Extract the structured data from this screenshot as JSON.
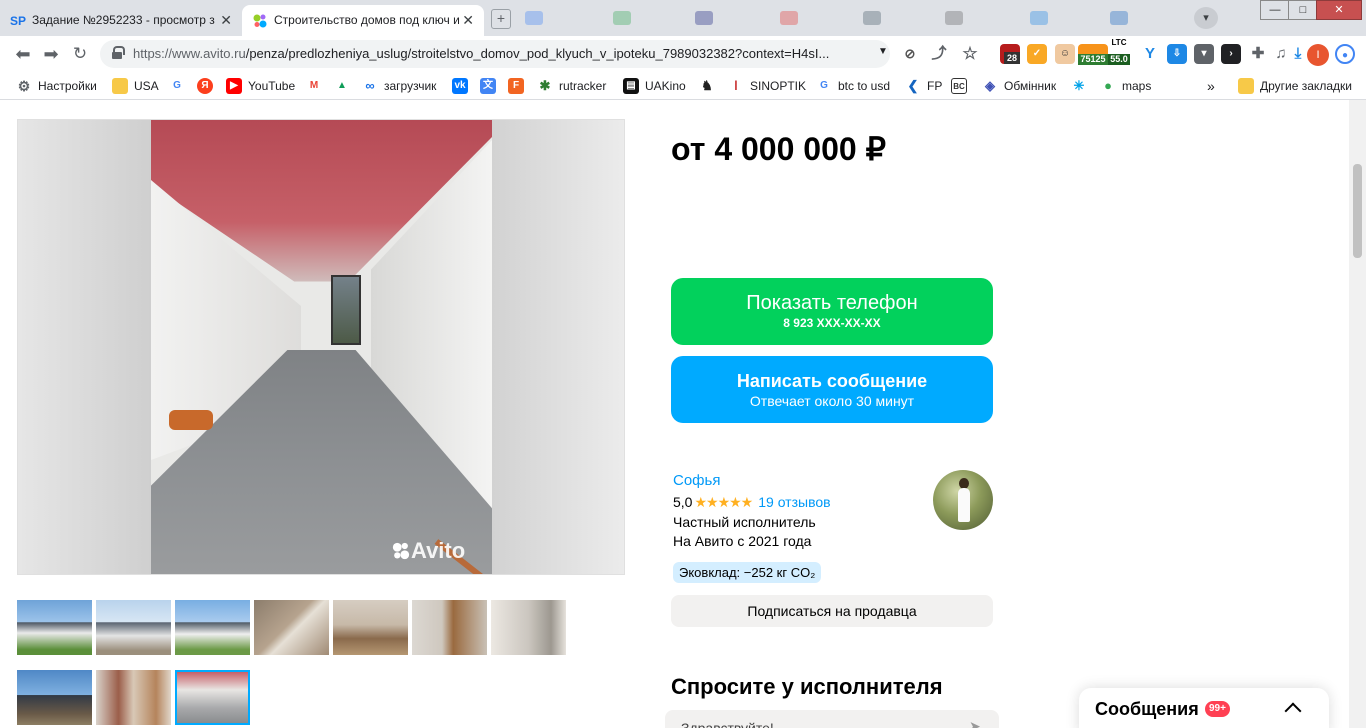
{
  "browser": {
    "tabs": [
      {
        "favicon": "SP",
        "title": "Задание №2952233 - просмотр з",
        "active": false
      },
      {
        "favicon": "avito-icon",
        "title": "Строительство домов под ключ и",
        "active": true
      }
    ],
    "url_prefix": "https://www.avito.ru",
    "url_path": "/penza/predlozheniya_uslug/stroitelstvo_domov_pod_klyuch_v_ipoteku_7989032382?context=H4sI...",
    "extension_badges": {
      "vpn": "28",
      "btc": "75125",
      "ltc_label": "LTC",
      "ltc": "55.0"
    },
    "profile_initial": "I",
    "window_controls": {
      "minimize": "—",
      "maximize": "□",
      "close": "✕"
    },
    "bookmarks": [
      {
        "label": "Настройки",
        "icon": "gear-icon",
        "color": "#5f6368"
      },
      {
        "label": "USA",
        "icon": "folder-icon",
        "color": "#f7c948"
      },
      {
        "label": "",
        "icon": "google-icon",
        "color": "#4285f4"
      },
      {
        "label": "",
        "icon": "yandex-icon",
        "color": "#fc3f1d"
      },
      {
        "label": "YouTube",
        "icon": "youtube-icon",
        "color": "#ff0000"
      },
      {
        "label": "",
        "icon": "gmail-icon",
        "color": "#ea4335"
      },
      {
        "label": "",
        "icon": "drive-icon",
        "color": "#0f9d58"
      },
      {
        "label": "загрузчик",
        "icon": "infinity-icon",
        "color": "#1a73e8"
      },
      {
        "label": "",
        "icon": "vk-icon",
        "color": "#0077ff"
      },
      {
        "label": "",
        "icon": "translate-icon",
        "color": "#4285f4"
      },
      {
        "label": "",
        "icon": "f-icon",
        "color": "#f26522"
      },
      {
        "label": "rutracker",
        "icon": "rutracker-icon",
        "color": "#2e7d32"
      },
      {
        "label": "UAKino",
        "icon": "film-icon",
        "color": "#111111"
      },
      {
        "label": "",
        "icon": "chess-icon",
        "color": "#222222"
      },
      {
        "label": "SINOPTIK",
        "icon": "thermometer-icon",
        "color": "#c62828"
      },
      {
        "label": "btc to usd",
        "icon": "google-icon",
        "color": "#4285f4"
      },
      {
        "label": "FP",
        "icon": "fp-icon",
        "color": "#1565c0"
      },
      {
        "label": "",
        "icon": "bc-icon",
        "color": "#333333"
      },
      {
        "label": "Обмінник",
        "icon": "exchange-icon",
        "color": "#3f51b5"
      },
      {
        "label": "",
        "icon": "spark-icon",
        "color": "#00a2e8"
      },
      {
        "label": "maps",
        "icon": "maps-icon",
        "color": "#34a853"
      }
    ],
    "bookmarks_overflow": "»",
    "other_bookmarks": "Другие закладки"
  },
  "listing": {
    "price": "от 4 000 000 ₽",
    "gallery_watermark": "Avito",
    "thumbnails_count": 10,
    "selected_thumbnail": 10,
    "show_phone": {
      "label": "Показать телефон",
      "phone": "8 923 XXX-XX-XX"
    },
    "write_message": {
      "label": "Написать сообщение",
      "sub": "Отвечает около 30 минут"
    },
    "seller": {
      "name": "Софья",
      "rating": "5,0",
      "stars": "★★★★★",
      "reviews": "19 отзывов",
      "type": "Частный исполнитель",
      "since": "На Авито с 2021 года",
      "eco": "Эковклад: −252 кг CO₂"
    },
    "subscribe": "Подписаться на продавца",
    "ask_title": "Спросите у исполнителя",
    "ask_placeholder": "Здравствуйте!"
  },
  "messages_widget": {
    "label": "Сообщения",
    "badge": "99+"
  },
  "colors": {
    "green": "#02d15c",
    "blue": "#00aaff",
    "link": "#0099f7",
    "star": "#ffb021",
    "badge": "#ff4053"
  }
}
